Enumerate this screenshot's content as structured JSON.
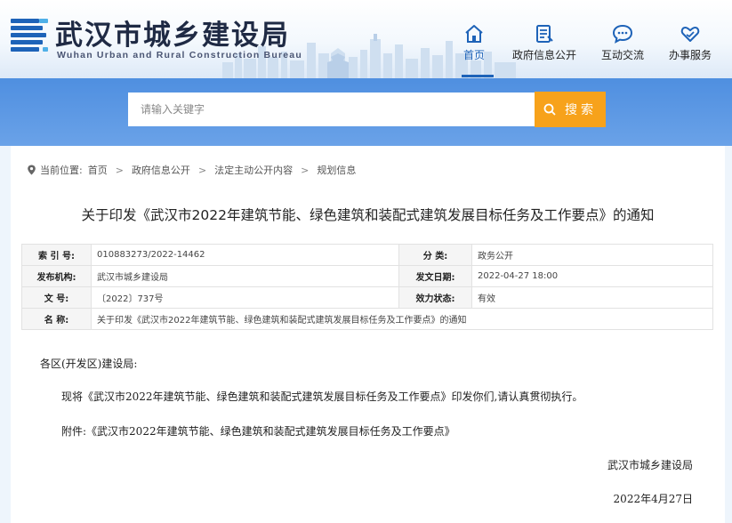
{
  "header": {
    "title_cn": "武汉市城乡建设局",
    "title_en": "Wuhan Urban and Rural Construction Bureau",
    "brand_color": "#1e63b8",
    "nav": [
      {
        "label": "首页",
        "icon": "home-icon",
        "active": true
      },
      {
        "label": "政府信息公开",
        "icon": "document-icon",
        "active": false
      },
      {
        "label": "互动交流",
        "icon": "chat-bubble-icon",
        "active": false
      },
      {
        "label": "办事服务",
        "icon": "heart-hand-icon",
        "active": false
      }
    ]
  },
  "search": {
    "placeholder": "请输入关键字",
    "button_label": "搜索",
    "button_color": "#f7a21b"
  },
  "breadcrumb": {
    "prefix": "当前位置:",
    "items": [
      "首页",
      "政府信息公开",
      "法定主动公开内容",
      "规划信息"
    ],
    "separator": ">"
  },
  "document": {
    "title": "关于印发《武汉市2022年建筑节能、绿色建筑和装配式建筑发展目标任务及工作要点》的通知",
    "meta": {
      "index_label": "索 引 号:",
      "index_value": "010883273/2022-14462",
      "category_label": "分    类:",
      "category_value": "政务公开",
      "issuer_label": "发布机构:",
      "issuer_value": "武汉市城乡建设局",
      "date_label": "发文日期:",
      "date_value": "2022-04-27 18:00",
      "docno_label": "文    号:",
      "docno_value": "〔2022〕737号",
      "status_label": "效力状态:",
      "status_value": "有效",
      "name_label": "名    称:",
      "name_value": "关于印发《武汉市2022年建筑节能、绿色建筑和装配式建筑发展目标任务及工作要点》的通知"
    },
    "salutation": "各区(开发区)建设局:",
    "paragraph1": "现将《武汉市2022年建筑节能、绿色建筑和装配式建筑发展目标任务及工作要点》印发你们,请认真贯彻执行。",
    "paragraph2": "附件:《武汉市2022年建筑节能、绿色建筑和装配式建筑发展目标任务及工作要点》",
    "signer": "武汉市城乡建设局",
    "date": "2022年4月27日"
  }
}
